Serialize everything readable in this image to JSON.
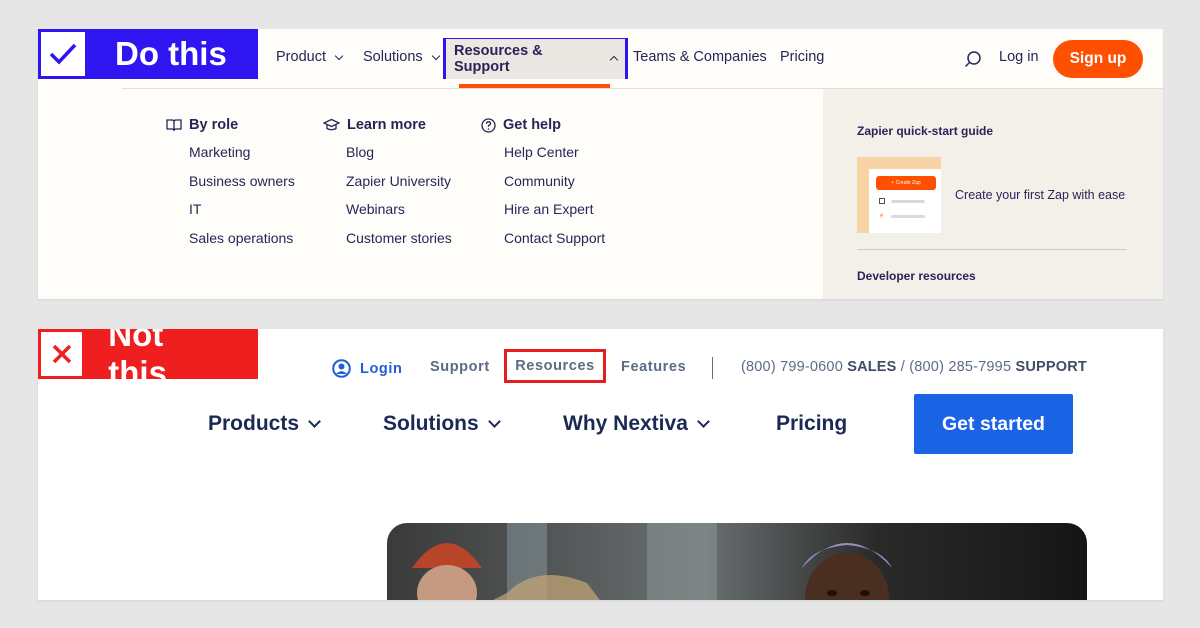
{
  "good_example": {
    "verdict_label": "Do this",
    "nav": {
      "product": "Product",
      "solutions": "Solutions",
      "resources": "Resources & Support",
      "teams": "Teams & Companies",
      "pricing": "Pricing",
      "login": "Log in",
      "signup": "Sign up"
    },
    "dropdown": {
      "columns": [
        {
          "heading": "By role",
          "items": [
            "Marketing",
            "Business owners",
            "IT",
            "Sales operations"
          ]
        },
        {
          "heading": "Learn more",
          "items": [
            "Blog",
            "Zapier University",
            "Webinars",
            "Customer stories"
          ]
        },
        {
          "heading": "Get help",
          "items": [
            "Help Center",
            "Community",
            "Hire an Expert",
            "Contact Support"
          ]
        }
      ],
      "sidebar": {
        "guide_title": "Zapier quick-start guide",
        "guide_button": "+ Create Zap",
        "guide_desc": "Create your first Zap with ease",
        "developer": "Developer resources"
      }
    },
    "colors": {
      "verdict": "#2f16f0",
      "accent": "#ff4f00",
      "text": "#2b2358"
    }
  },
  "bad_example": {
    "verdict_label": "Not this",
    "top_nav": {
      "login": "Login",
      "support": "Support",
      "resources": "Resources",
      "features": "Features",
      "phone_sales_number": "(800) 799-0600",
      "phone_sales_label": "SALES",
      "separator": "/",
      "phone_support_number": "(800) 285-7995",
      "phone_support_label": "SUPPORT"
    },
    "main_nav": {
      "products": "Products",
      "solutions": "Solutions",
      "why": "Why Nextiva",
      "pricing": "Pricing",
      "cta": "Get started"
    },
    "colors": {
      "verdict": "#ef1f1f",
      "cta": "#1b63e5",
      "nav_text": "#1a2a55"
    }
  }
}
